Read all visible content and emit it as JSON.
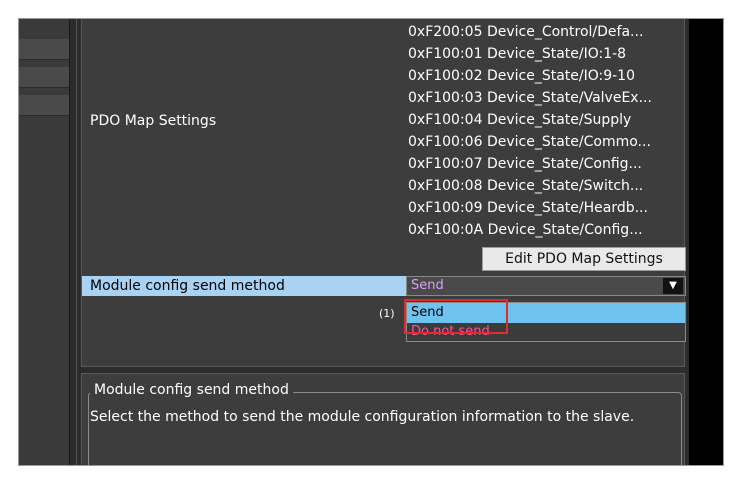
{
  "pdo_section": {
    "label": "PDO Map Settings",
    "entries": [
      "0xF200:05 Device_Control/Defa...",
      "0xF100:01 Device_State/IO:1-8",
      "0xF100:02 Device_State/IO:9-10",
      "0xF100:03 Device_State/ValveEx...",
      "0xF100:04 Device_State/Supply",
      "0xF100:06 Device_State/Commo...",
      "0xF100:07 Device_State/Config...",
      "0xF100:08 Device_State/Switch...",
      "0xF100:09 Device_State/Heardb...",
      "0xF100:0A Device_State/Config..."
    ],
    "edit_button_label": "Edit PDO Map Settings"
  },
  "module_config": {
    "label": "Module config send method",
    "selected_value": "Send",
    "options": [
      "Send",
      "Do not send"
    ],
    "callout": "(1)"
  },
  "description": {
    "title": "Module config send method",
    "text": "Select the method to send the module configuration information to the slave."
  },
  "colors": {
    "row_highlight": "#a8d3f5",
    "option_highlight": "#6ec3ef",
    "selected_text": "#d8a0f8",
    "do_not_send_text": "#ff4f9a",
    "callout_box": "#e32b2b"
  }
}
